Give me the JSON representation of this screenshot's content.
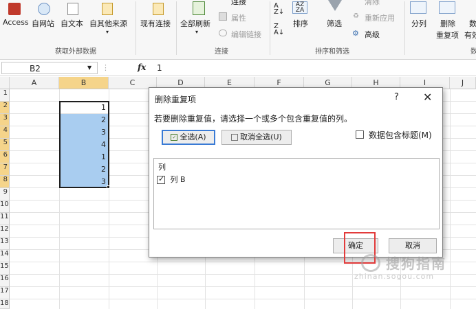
{
  "ribbon": {
    "external": {
      "access": "Access",
      "web": "自网站",
      "text": "自文本",
      "other": "自其他来源",
      "existing": "现有连接",
      "group_name": "获取外部数据"
    },
    "connections": {
      "refresh_all": "全部刷新",
      "connections": "连接",
      "properties": "属性",
      "edit_links": "编辑链接",
      "group_name": "连接"
    },
    "sort_filter": {
      "sort": "排序",
      "filter": "筛选",
      "clear": "清除",
      "reapply": "重新应用",
      "advanced": "高级",
      "group_name": "排序和筛选"
    },
    "data_tools": {
      "split": "分列",
      "remove_line1": "删除",
      "remove_line2": "重复项",
      "truncated_label": "有效",
      "truncated_top": "数",
      "group_name_partial": "数"
    }
  },
  "formula_bar": {
    "name_box": "B2",
    "fx": "fx",
    "value": "1"
  },
  "grid": {
    "columns": [
      "A",
      "B",
      "C",
      "D",
      "E",
      "F",
      "G",
      "H",
      "I",
      "J"
    ],
    "rows": [
      "1",
      "2",
      "3",
      "4",
      "5",
      "6",
      "7",
      "8",
      "9",
      "10",
      "11",
      "12",
      "13",
      "14",
      "15",
      "16",
      "17",
      "18"
    ],
    "column_b_values": [
      "1",
      "2",
      "3",
      "4",
      "1",
      "2",
      "3"
    ]
  },
  "dialog": {
    "title": "删除重复项",
    "help": "?",
    "close": "✕",
    "description": "若要删除重复值，请选择一个或多个包含重复值的列。",
    "select_all": "全选(A)",
    "unselect_all": "取消全选(U)",
    "has_headers_label": "数据包含标题(M)",
    "has_headers_checked": false,
    "list_header": "列",
    "list_items": [
      {
        "label": "列 B",
        "checked": true
      }
    ],
    "ok": "确定",
    "cancel": "取消"
  },
  "watermark": {
    "main": "搜狗指南",
    "sub": "zhinan.sogou.com"
  },
  "colors": {
    "selection_fill": "#a9cdf0",
    "header_highlight": "#f5d48a",
    "annotation_red": "#e23b3b",
    "ribbon_bg": "#f7f7f7"
  }
}
